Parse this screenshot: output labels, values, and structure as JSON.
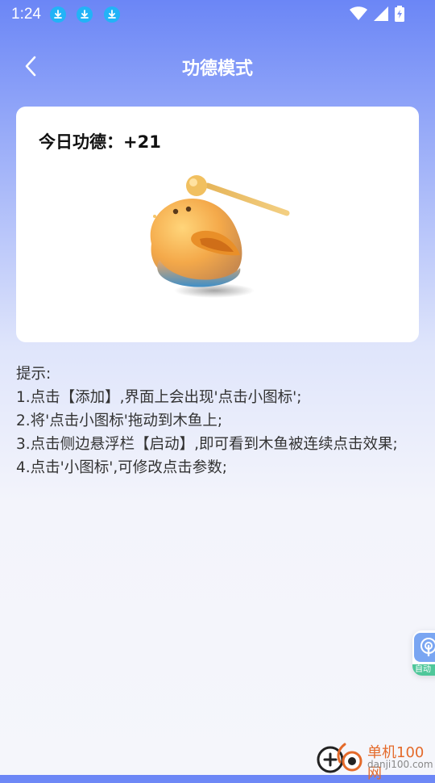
{
  "status_bar": {
    "time": "1:24",
    "download_icons": [
      "download-icon",
      "download-icon",
      "download-icon"
    ],
    "system_icons": [
      "wifi-icon",
      "signal-icon",
      "battery-charging-icon"
    ]
  },
  "header": {
    "title": "功德模式",
    "back_icon": "chevron-left-icon"
  },
  "card": {
    "merit_label": "今日功德：+21",
    "image": "wooden-fish-with-mallet"
  },
  "tips": {
    "heading": "提示:",
    "lines": [
      "1.点击【添加】,界面上会出现'点击小图标';",
      "2.将'点击小图标'拖动到木鱼上;",
      "3.点击侧边悬浮栏【启动】,即可看到木鱼被连续点击效果;",
      "4.点击'小图标',可修改点击参数;"
    ]
  },
  "float_bar": {
    "icon": "touch-icon",
    "label": "自动"
  },
  "watermark": {
    "line1": "单机100网",
    "line2": "danji100.com"
  },
  "colors": {
    "gradient_top": "#6b86f6",
    "background": "#f5f6fb",
    "card": "#ffffff",
    "download_badge": "#22b3f7",
    "float_label": "#4fc79a"
  }
}
